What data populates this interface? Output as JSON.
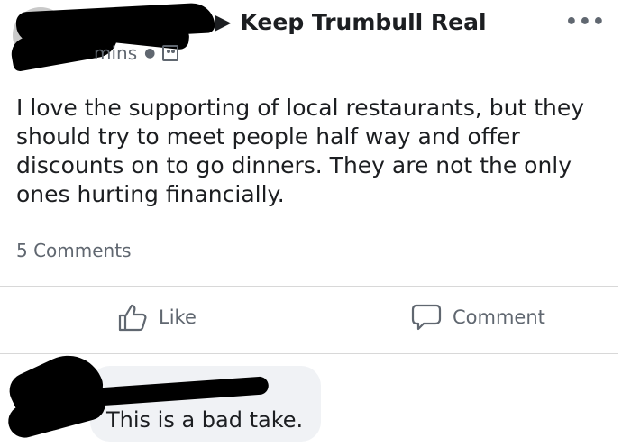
{
  "post": {
    "group_name": "Keep Trumbull Real",
    "time_fragment": "mins",
    "body": "I love the supporting of local restaurants, but they should try to meet people half way and offer discounts on to go dinners. They are not the only ones hurting financially.",
    "comment_count": "5 Comments"
  },
  "actions": {
    "like_label": "Like",
    "comment_label": "Comment"
  },
  "comments": [
    {
      "text": "This is a bad take."
    }
  ],
  "icons": {
    "more": "more-options-icon",
    "arrow": "right-arrow-icon",
    "privacy": "group-privacy-icon",
    "like": "thumbs-up-icon",
    "comment": "speech-bubble-icon"
  }
}
